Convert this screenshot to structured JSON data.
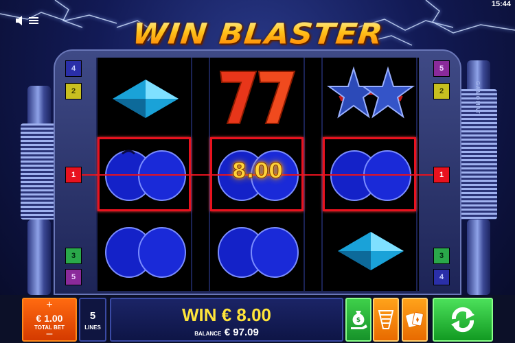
{
  "status": {
    "clock": "15:44"
  },
  "header": {
    "sound_icon": "speaker-icon",
    "menu_icon": "hamburger-icon",
    "logo_text": "WIN BLASTER"
  },
  "brand": {
    "vertical_label": "GAMOMAT"
  },
  "reels": [
    [
      "diamond",
      "plum",
      "plum"
    ],
    [
      "seven",
      "plum",
      "plum"
    ],
    [
      "star",
      "plum",
      "diamond"
    ]
  ],
  "win_overlay": {
    "amount": "8.00"
  },
  "line_markers": {
    "left_top": [
      "4",
      "2"
    ],
    "left_middle": "1",
    "left_bottom": [
      "3",
      "5"
    ],
    "right_top": [
      "5",
      "2"
    ],
    "right_middle": "1",
    "right_bottom": [
      "3",
      "4"
    ]
  },
  "bottom_bar": {
    "bet_plus": "+",
    "bet_value": "€ 1.00",
    "bet_label": "TOTAL BET",
    "bet_minus": "–",
    "lines_value": "5",
    "lines_label": "LINES",
    "win_text": "WIN € 8.00",
    "balance_label": "BALANCE",
    "balance_value": "€ 97.09",
    "buttons": [
      {
        "name": "gamble-button",
        "icon": "money-bag-hand-icon"
      },
      {
        "name": "paytable-button",
        "icon": "paytable-icon"
      },
      {
        "name": "card-gamble-button",
        "icon": "cards-icon"
      },
      {
        "name": "spin-button",
        "icon": "spin-arrows-icon"
      }
    ]
  },
  "colors": {
    "win_highlight": "#e8121e",
    "win_text": "#ffe53a",
    "bet_orange": "#ff6a10",
    "spin_green": "#2bc23a"
  }
}
